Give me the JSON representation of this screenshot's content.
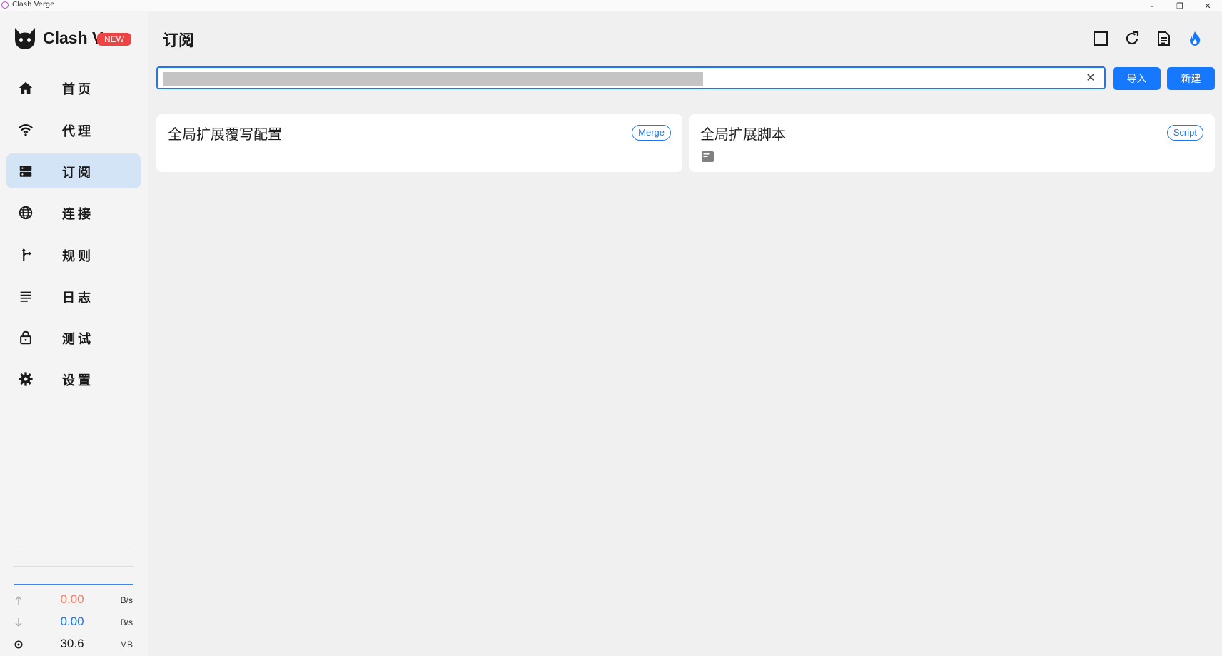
{
  "window": {
    "title": "Clash Verge",
    "controls": [
      "minimize-icon",
      "restore-icon",
      "close-icon"
    ]
  },
  "sidebar": {
    "logo_text": "Clash V",
    "new_badge": "NEW",
    "items": [
      {
        "label": "首页",
        "icon": "home-icon",
        "active": false
      },
      {
        "label": "代理",
        "icon": "wifi-icon",
        "active": false
      },
      {
        "label": "订阅",
        "icon": "server-icon",
        "active": true
      },
      {
        "label": "连接",
        "icon": "globe-icon",
        "active": false
      },
      {
        "label": "规则",
        "icon": "fork-arrow-icon",
        "active": false
      },
      {
        "label": "日志",
        "icon": "list-lines-icon",
        "active": false
      },
      {
        "label": "测试",
        "icon": "lock-icon",
        "active": false
      },
      {
        "label": "设置",
        "icon": "gear-icon",
        "active": false
      }
    ],
    "traffic": {
      "upload": {
        "value": "0.00",
        "unit": "B/s",
        "color": "#f0806a"
      },
      "download": {
        "value": "0.00",
        "unit": "B/s",
        "color": "#1677ff"
      },
      "memory": {
        "value": "30.6",
        "unit": "MB"
      }
    }
  },
  "header": {
    "title": "订阅",
    "icons": [
      "square-icon",
      "refresh-icon",
      "document-icon",
      "fire-icon"
    ]
  },
  "search": {
    "placeholder": "",
    "import_label": "导入",
    "new_label": "新建"
  },
  "cards": [
    {
      "title": "全局扩展覆写配置",
      "tag": "Merge"
    },
    {
      "title": "全局扩展脚本",
      "tag": "Script"
    }
  ],
  "colors": {
    "accent": "#1677ff",
    "badge": "#ef4444",
    "active_nav": "#d3e4f7"
  }
}
